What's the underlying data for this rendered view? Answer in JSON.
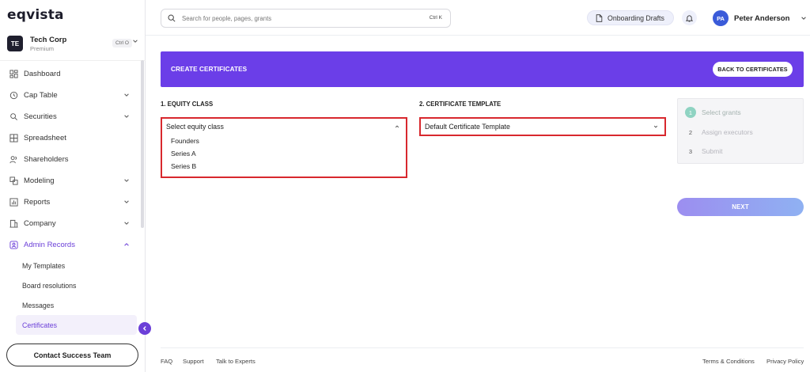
{
  "brand": {
    "logo": "eqvista"
  },
  "company": {
    "initials": "TE",
    "name": "Tech Corp",
    "plan": "Premium",
    "shortcut": "Ctrl O"
  },
  "sidebar": {
    "items": [
      {
        "label": "Dashboard",
        "icon": "dashboard-icon"
      },
      {
        "label": "Cap Table",
        "icon": "clock-icon"
      },
      {
        "label": "Securities",
        "icon": "securities-icon"
      },
      {
        "label": "Spreadsheet",
        "icon": "grid-icon"
      },
      {
        "label": "Shareholders",
        "icon": "users-icon"
      },
      {
        "label": "Modeling",
        "icon": "modeling-icon"
      },
      {
        "label": "Reports",
        "icon": "reports-icon"
      },
      {
        "label": "Company",
        "icon": "company-icon"
      },
      {
        "label": "Admin Records",
        "icon": "admin-records-icon"
      }
    ],
    "sub_items": [
      {
        "label": "My Templates"
      },
      {
        "label": "Board resolutions"
      },
      {
        "label": "Messages"
      },
      {
        "label": "Certificates"
      }
    ],
    "contact_label": "Contact Success Team"
  },
  "header": {
    "search_placeholder": "Search for people, pages, grants",
    "search_shortcut": "Ctrl K",
    "drafts_label": "Onboarding Drafts",
    "user_initials": "PA",
    "user_name": "Peter Anderson"
  },
  "main": {
    "banner_title": "CREATE CERTIFICATES",
    "back_label": "BACK TO CERTIFICATES",
    "equity_label": "1. EQUITY CLASS",
    "equity_placeholder": "Select equity class",
    "equity_options": [
      "Founders",
      "Series A",
      "Series B"
    ],
    "template_label": "2. CERTIFICATE TEMPLATE",
    "template_value": "Default Certificate Template",
    "steps": [
      {
        "num": "1",
        "label": "Select grants"
      },
      {
        "num": "2",
        "label": "Assign executors"
      },
      {
        "num": "3",
        "label": "Submit"
      }
    ],
    "next_label": "NEXT"
  },
  "footer": {
    "links_left": [
      "FAQ",
      "Support",
      "Talk to Experts"
    ],
    "links_right": [
      "Terms & Conditions",
      "Privacy Policy"
    ]
  },
  "colors": {
    "accent": "#6b3ee8",
    "highlight": "#d8282e",
    "step_active": "#8fd3c2"
  }
}
